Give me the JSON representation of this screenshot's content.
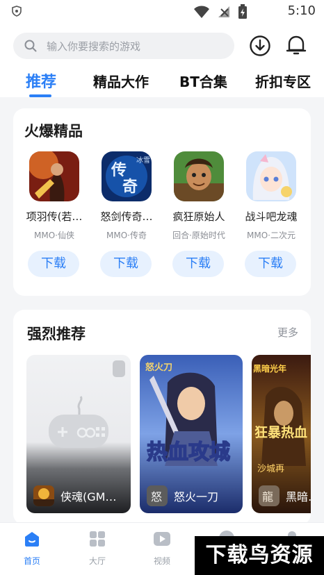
{
  "status": {
    "time": "5:10"
  },
  "search": {
    "placeholder": "输入你要搜索的游戏"
  },
  "tabs": [
    {
      "label": "推荐",
      "active": true
    },
    {
      "label": "精品大作"
    },
    {
      "label": "BT合集"
    },
    {
      "label": "折扣专区"
    }
  ],
  "hot": {
    "title": "火爆精品",
    "games": [
      {
        "name": "项羽传(若…",
        "tag": "MMO·仙侠",
        "button": "下载",
        "icon": "hero-red-icon"
      },
      {
        "name": "怒剑传奇…",
        "tag": "MMO·传奇",
        "button": "下载",
        "icon": "legend-blue-icon"
      },
      {
        "name": "疯狂原始人",
        "tag": "回合·原始时代",
        "button": "下载",
        "icon": "caveman-icon"
      },
      {
        "name": "战斗吧龙魂",
        "tag": "MMO·二次元",
        "button": "下载",
        "icon": "anime-girl-icon"
      }
    ]
  },
  "recommend": {
    "title": "强烈推荐",
    "more": "更多",
    "items": [
      {
        "name": "侠魂(GM…",
        "art_text": ""
      },
      {
        "name": "怒火一刀",
        "art_text": "热血攻城"
      },
      {
        "name": "黑暗…",
        "art_text": "狂暴热血"
      }
    ]
  },
  "nav": [
    {
      "label": "首页",
      "active": true,
      "icon": "home-icon"
    },
    {
      "label": "大厅",
      "icon": "grid-icon"
    },
    {
      "label": "视频",
      "icon": "video-icon"
    },
    {
      "label": "",
      "icon": "chat-icon"
    },
    {
      "label": "",
      "icon": "profile-icon"
    }
  ],
  "watermark": "下载鸟资源",
  "colors": {
    "accent": "#2b7ff6",
    "download_bg": "#e7f1fe"
  }
}
